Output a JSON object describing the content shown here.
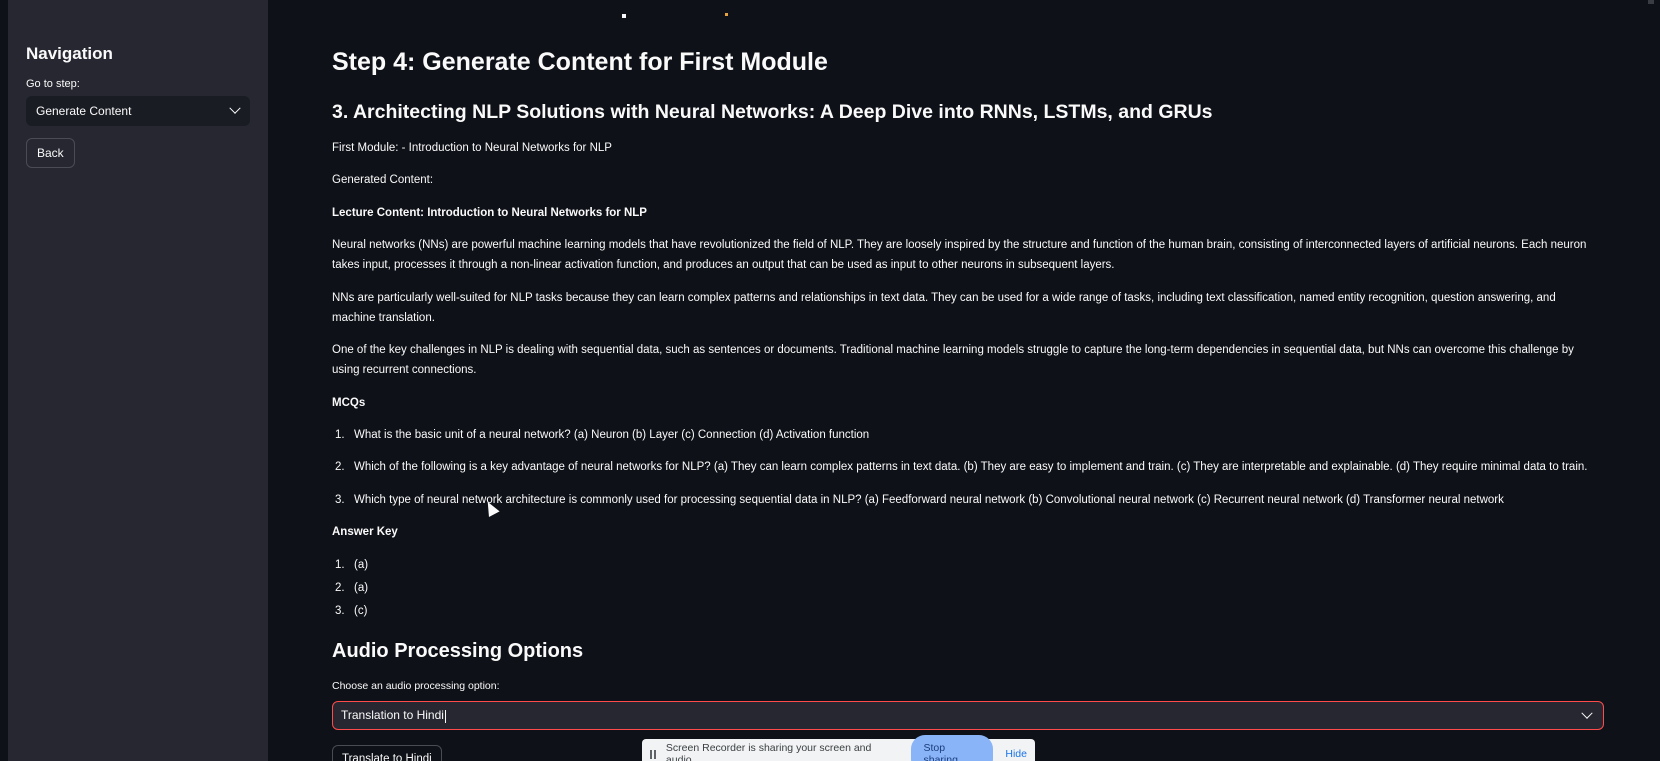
{
  "sidebar": {
    "title": "Navigation",
    "step_label": "Go to step:",
    "step_value": "Generate Content",
    "back_label": "Back"
  },
  "main": {
    "step_heading": "Step 4: Generate Content for First Module",
    "course_title": "3. Architecting NLP Solutions with Neural Networks: A Deep Dive into RNNs, LSTMs, and GRUs",
    "first_module": "First Module: - Introduction to Neural Networks for NLP",
    "generated_label": "Generated Content:",
    "lecture_heading": "Lecture Content: Introduction to Neural Networks for NLP",
    "paragraphs": [
      "Neural networks (NNs) are powerful machine learning models that have revolutionized the field of NLP. They are loosely inspired by the structure and function of the human brain, consisting of interconnected layers of artificial neurons. Each neuron takes input, processes it through a non-linear activation function, and produces an output that can be used as input to other neurons in subsequent layers.",
      "NNs are particularly well-suited for NLP tasks because they can learn complex patterns and relationships in text data. They can be used for a wide range of tasks, including text classification, named entity recognition, question answering, and machine translation.",
      "One of the key challenges in NLP is dealing with sequential data, such as sentences or documents. Traditional machine learning models struggle to capture the long-term dependencies in sequential data, but NNs can overcome this challenge by using recurrent connections."
    ],
    "mcq_heading": "MCQs",
    "mcqs": [
      {
        "num": "1.",
        "text": "What is the basic unit of a neural network? (a) Neuron (b) Layer (c) Connection (d) Activation function"
      },
      {
        "num": "2.",
        "text": "Which of the following is a key advantage of neural networks for NLP? (a) They can learn complex patterns in text data. (b) They are easy to implement and train. (c) They are interpretable and explainable. (d) They require minimal data to train."
      },
      {
        "num": "3.",
        "text": "Which type of neural network architecture is commonly used for processing sequential data in NLP? (a) Feedforward neural network (b) Convolutional neural network (c) Recurrent neural network (d) Transformer neural network"
      }
    ],
    "answer_heading": "Answer Key",
    "answers": [
      {
        "num": "1.",
        "text": "(a)"
      },
      {
        "num": "2.",
        "text": "(a)"
      },
      {
        "num": "3.",
        "text": "(c)"
      }
    ],
    "audio_heading": "Audio Processing Options",
    "audio_label": "Choose an audio processing option:",
    "audio_value": "Translation to Hindi",
    "translate_button": "Translate to Hindi"
  },
  "recorder": {
    "message": "Screen Recorder is sharing your screen and audio.",
    "stop_label": "Stop sharing",
    "hide_label": "Hide"
  },
  "colors": {
    "background": "#0e1117",
    "sidebar": "#262730",
    "accent_border": "#ff4b4b",
    "stop_button": "#8ab4f8"
  }
}
